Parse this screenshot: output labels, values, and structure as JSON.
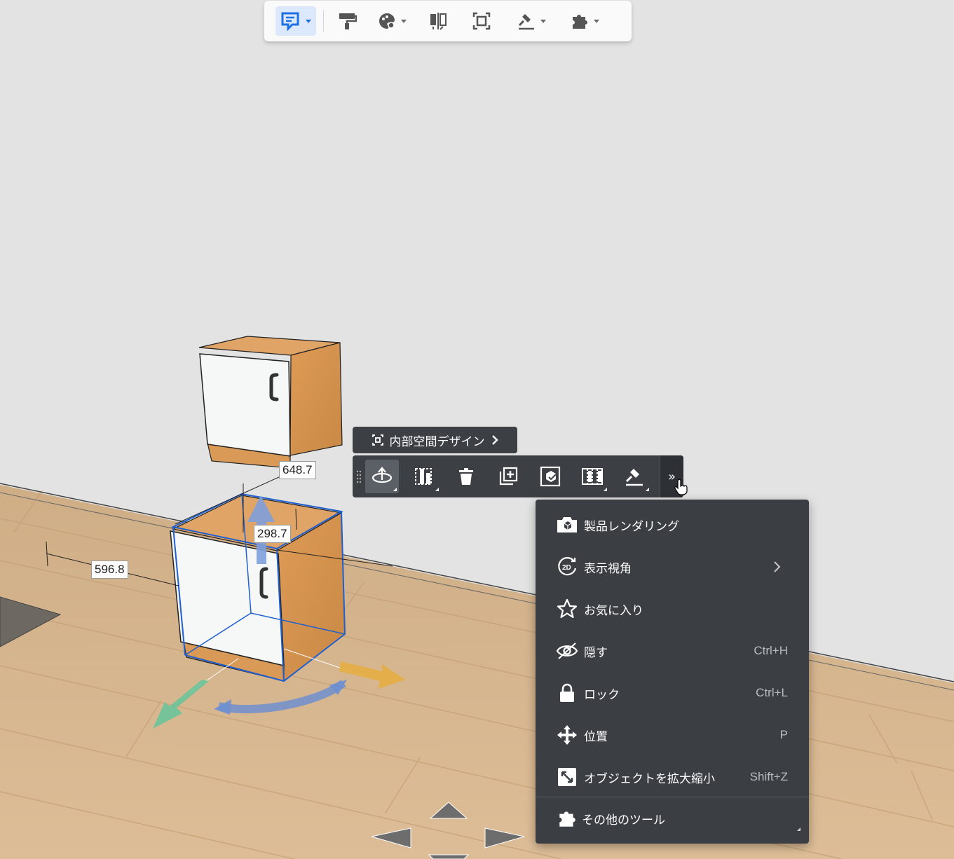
{
  "toolbar": {
    "items": [
      {
        "name": "annotate",
        "icon": "annotation-icon",
        "active": true,
        "dropdown": true
      },
      {
        "name": "paint",
        "icon": "paint-roller-icon",
        "dropdown": false
      },
      {
        "name": "material",
        "icon": "palette-icon",
        "dropdown": true
      },
      {
        "name": "mirror",
        "icon": "mirror-icon",
        "dropdown": false
      },
      {
        "name": "select-frame",
        "icon": "frame-select-icon",
        "dropdown": false
      },
      {
        "name": "measure",
        "icon": "gavel-icon",
        "dropdown": true
      },
      {
        "name": "plugins",
        "icon": "puzzle-icon",
        "dropdown": true
      }
    ],
    "accent_color": "#1f6fe5"
  },
  "dimensions": {
    "height_label": "648.7",
    "depth_label": "298.7",
    "width_label": "596.8"
  },
  "interior_button": {
    "label": "内部空間デザイン",
    "icon": "interior-frame-icon",
    "arrow": "chevron-right-icon"
  },
  "object_toolbar": {
    "buttons": [
      {
        "name": "rotate",
        "icon": "rotate-icon",
        "active": true
      },
      {
        "name": "split",
        "icon": "split-icon"
      },
      {
        "name": "delete",
        "icon": "trash-icon"
      },
      {
        "name": "duplicate",
        "icon": "duplicate-icon"
      },
      {
        "name": "replace",
        "icon": "replace-icon"
      },
      {
        "name": "array",
        "icon": "array-icon"
      },
      {
        "name": "measure",
        "icon": "gavel-icon"
      }
    ],
    "more_label": "»"
  },
  "context_menu": {
    "items": [
      {
        "label": "製品レンダリング",
        "icon": "render-camera-icon",
        "shortcut": ""
      },
      {
        "label": "表示視角",
        "icon": "view-2d-icon",
        "shortcut": "",
        "submenu": true
      },
      {
        "label": "お気に入り",
        "icon": "star-icon",
        "shortcut": ""
      },
      {
        "label": "隠す",
        "icon": "eye-hidden-icon",
        "shortcut": "Ctrl+H"
      },
      {
        "label": "ロック",
        "icon": "lock-icon",
        "shortcut": "Ctrl+L"
      },
      {
        "label": "位置",
        "icon": "move-icon",
        "shortcut": "P"
      },
      {
        "label": "オブジェクトを拡大縮小",
        "icon": "scale-icon",
        "shortcut": "Shift+Z"
      }
    ],
    "footer": {
      "label": "その他のツール",
      "icon": "puzzle-icon"
    }
  },
  "colors": {
    "scene_bg": "#e3e3e3",
    "floor": "#d6b48b",
    "wood": "#d99a58",
    "door": "#f5f6f6",
    "selection": "#1f5fd0",
    "dark_panel": "#3c3f44"
  }
}
